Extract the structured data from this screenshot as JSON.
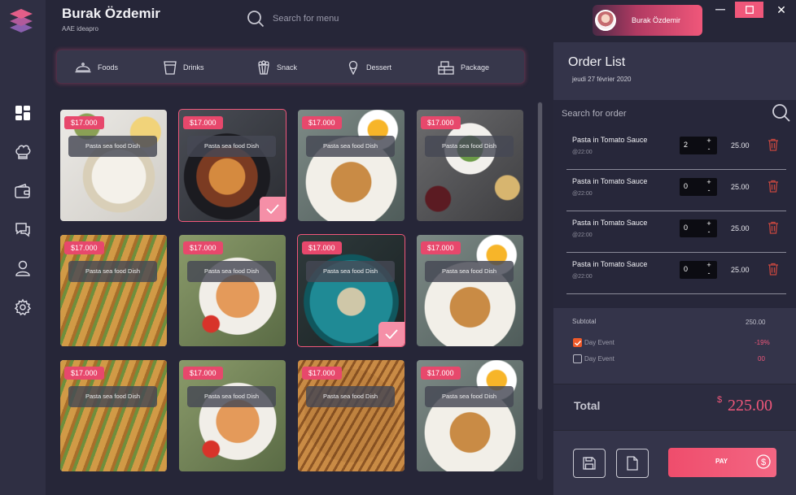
{
  "header": {
    "user_name": "Burak Özdemir",
    "org": "AAE ideapro",
    "search_placeholder": "Search for menu",
    "profile_name": "Burak Özdemir"
  },
  "window": {
    "close_label": "✕"
  },
  "sidebar": {
    "items": [
      {
        "icon": "dashboard-icon"
      },
      {
        "icon": "chef-hat-icon"
      },
      {
        "icon": "wallet-icon"
      },
      {
        "icon": "chat-icon"
      },
      {
        "icon": "user-icon"
      },
      {
        "icon": "gear-icon"
      }
    ]
  },
  "categories": [
    {
      "label": "Foods",
      "icon": "cloche-icon"
    },
    {
      "label": "Drinks",
      "icon": "cup-icon"
    },
    {
      "label": "Snack",
      "icon": "popcorn-icon"
    },
    {
      "label": "Dessert",
      "icon": "ice-cream-icon"
    },
    {
      "label": "Package",
      "icon": "package-icon"
    }
  ],
  "menu": {
    "items": [
      {
        "price": "$17.000",
        "name": "Pasta sea food Dish",
        "selected": false
      },
      {
        "price": "$17.000",
        "name": "Pasta sea food Dish",
        "selected": true
      },
      {
        "price": "$17.000",
        "name": "Pasta sea food Dish",
        "selected": false
      },
      {
        "price": "$17.000",
        "name": "Pasta sea food Dish",
        "selected": false
      },
      {
        "price": "$17.000",
        "name": "Pasta sea food Dish",
        "selected": false
      },
      {
        "price": "$17.000",
        "name": "Pasta sea food Dish",
        "selected": false
      },
      {
        "price": "$17.000",
        "name": "Pasta sea food Dish",
        "selected": true
      },
      {
        "price": "$17.000",
        "name": "Pasta sea food Dish",
        "selected": false
      },
      {
        "price": "$17.000",
        "name": "Pasta sea food Dish",
        "selected": false
      },
      {
        "price": "$17.000",
        "name": "Pasta sea food Dish",
        "selected": false
      },
      {
        "price": "$17.000",
        "name": "Pasta sea food Dish",
        "selected": false
      },
      {
        "price": "$17.000",
        "name": "Pasta sea food Dish",
        "selected": false
      }
    ]
  },
  "order": {
    "title": "Order List",
    "date": "jeudi 27 février 2020",
    "search_placeholder": "Search for order",
    "items": [
      {
        "name": "Pasta in Tomato Sauce",
        "time": "@22:00",
        "qty": "2",
        "price": "25.00"
      },
      {
        "name": "Pasta in Tomato Sauce",
        "time": "@22:00",
        "qty": "0",
        "price": "25.00"
      },
      {
        "name": "Pasta in Tomato Sauce",
        "time": "@22:00",
        "qty": "0",
        "price": "25.00"
      },
      {
        "name": "Pasta in Tomato Sauce",
        "time": "@22:00",
        "qty": "0",
        "price": "25.00"
      }
    ],
    "stepper_plus": "+",
    "stepper_minus": "-",
    "subtotal_label": "Subtotal",
    "subtotal_value": "250.00",
    "discounts": [
      {
        "label": "Day Event",
        "value": "-19%",
        "checked": true
      },
      {
        "label": "Day Event",
        "value": "00",
        "checked": false
      }
    ],
    "total_label": "Total",
    "total_currency": "$",
    "total_value": "225.00",
    "pay_label": "PAY"
  },
  "colors": {
    "accent": "#f0577a",
    "background": "#262638",
    "panel": "#34344a"
  }
}
